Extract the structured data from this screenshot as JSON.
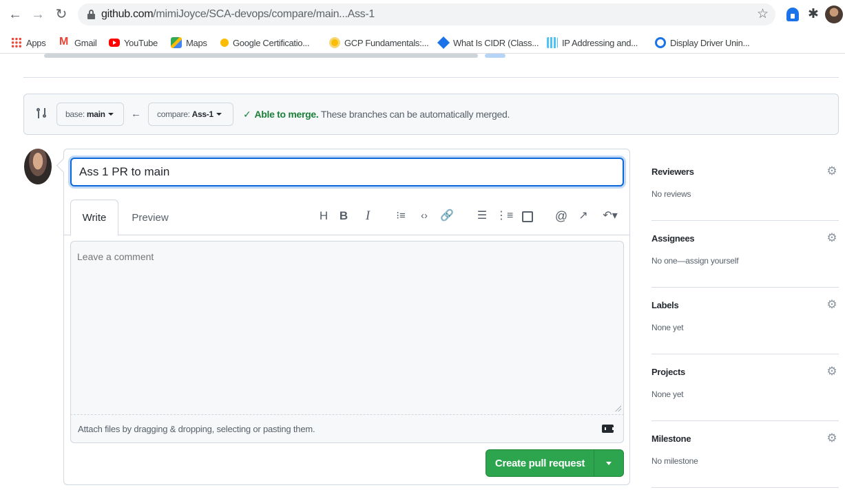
{
  "browser": {
    "url_domain": "github.com",
    "url_path": "/mimiJoyce/SCA-devops/compare/main...Ass-1",
    "back_glyph": "←",
    "forward_glyph": "→",
    "reload_glyph": "↻",
    "star_glyph": "☆",
    "extensions_glyph": "✱",
    "bookmarks": [
      {
        "label": "Apps",
        "icon": "apps-grid-icon"
      },
      {
        "label": "Gmail",
        "icon": "gmail-icon"
      },
      {
        "label": "YouTube",
        "icon": "youtube-icon"
      },
      {
        "label": "Maps",
        "icon": "maps-icon"
      },
      {
        "label": "Google Certificatio...",
        "icon": "google-cert-icon"
      },
      {
        "label": "GCP Fundamentals:...",
        "icon": "gcp-icon"
      },
      {
        "label": "What Is CIDR (Class...",
        "icon": "cidr-icon"
      },
      {
        "label": "IP Addressing and...",
        "icon": "ip-addressing-icon"
      },
      {
        "label": "Display Driver Unin...",
        "icon": "ddu-icon"
      }
    ]
  },
  "compare": {
    "base_prefix": "base:",
    "base_branch": "main",
    "arrow_glyph": "←",
    "compare_prefix": "compare:",
    "compare_branch": "Ass-1",
    "check_glyph": "✓",
    "merge_ok": "Able to merge.",
    "merge_desc": "These branches can be automatically merged.",
    "status_color": "#1a7f37"
  },
  "form": {
    "title_value": "Ass 1 PR to main",
    "tab_write": "Write",
    "tab_preview": "Preview",
    "toolbar": {
      "heading": "H",
      "bold": "B",
      "italic": "I",
      "quote": "⁝≡",
      "code": "‹›",
      "link": "🔗",
      "unordered_list": "☰",
      "ordered_list": "⋮≡",
      "mention": "@",
      "reference": "↗",
      "reply": "↶▾"
    },
    "comment_placeholder": "Leave a comment",
    "attach_text": "Attach files by dragging & dropping, selecting or pasting them.",
    "submit_label": "Create pull request",
    "submit_color": "#2da44e"
  },
  "sidebar": {
    "gear_glyph": "⚙",
    "sections": [
      {
        "title": "Reviewers",
        "value": "No reviews"
      },
      {
        "title": "Assignees",
        "value": "No one—assign yourself"
      },
      {
        "title": "Labels",
        "value": "None yet"
      },
      {
        "title": "Projects",
        "value": "None yet"
      },
      {
        "title": "Milestone",
        "value": "No milestone"
      }
    ]
  }
}
